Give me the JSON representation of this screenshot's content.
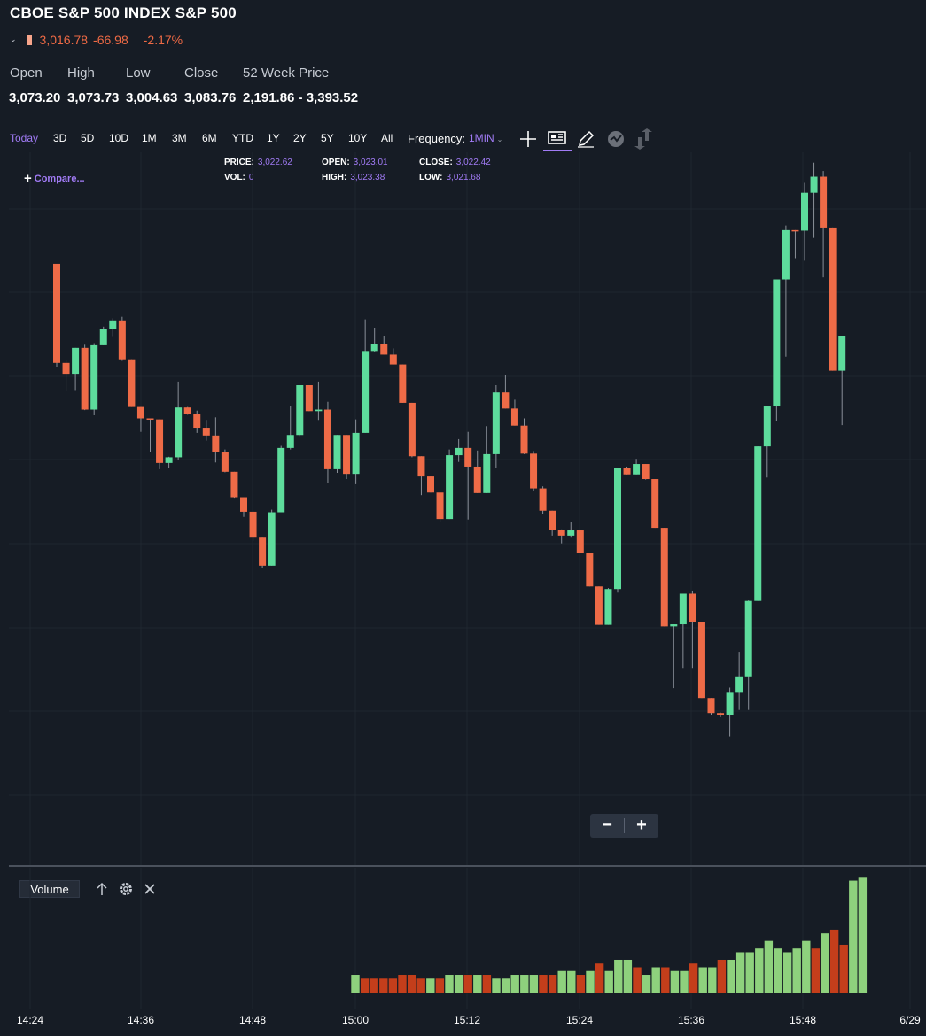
{
  "header": {
    "title": "CBOE S&P 500 INDEX S&P 500",
    "price": "3,016.78",
    "change": "-66.98",
    "change_pct": "-2.17%"
  },
  "stats": [
    {
      "label": "Open",
      "value": "3,073.20"
    },
    {
      "label": "High",
      "value": "3,073.73"
    },
    {
      "label": "Low",
      "value": "3,004.63"
    },
    {
      "label": "Close",
      "value": "3,083.76"
    },
    {
      "label": "52 Week Price",
      "value": "2,191.86 - 3,393.52"
    }
  ],
  "toolbar": {
    "ranges": [
      "Today",
      "3D",
      "5D",
      "10D",
      "1M",
      "3M",
      "6M",
      "YTD",
      "1Y",
      "2Y",
      "5Y",
      "10Y",
      "All"
    ],
    "active_range": "Today",
    "frequency_label": "Frequency:",
    "frequency_value": "1MIN",
    "icons": [
      "crosshair-icon",
      "news-icon",
      "draw-pencil-icon",
      "events-icon",
      "share-icon"
    ]
  },
  "crosshair_info": {
    "price_label": "PRICE:",
    "price": "3,022.62",
    "open_label": "OPEN:",
    "open": "3,023.01",
    "close_label": "CLOSE:",
    "close": "3,022.42",
    "vol_label": "VOL:",
    "vol": "0",
    "high_label": "HIGH:",
    "high": "3,023.38",
    "low_label": "LOW:",
    "low": "3,021.68"
  },
  "compare": {
    "plus": "+",
    "label": "Compare..."
  },
  "zoom": {
    "minus": "−",
    "plus": "+"
  },
  "volume_panel": {
    "label": "Volume",
    "icons": [
      "arrow-up-icon",
      "gear-icon",
      "close-icon"
    ]
  },
  "colors": {
    "up": "#5ddc9c",
    "down": "#ee6b47",
    "vol_up": "#8ed17d",
    "vol_down": "#c43e1b",
    "accent": "#a17bf5",
    "background": "#161c25"
  },
  "x_axis": {
    "labels": [
      "14:24",
      "14:36",
      "14:48",
      "15:00",
      "15:12",
      "15:24",
      "15:36",
      "15:48",
      "6/29"
    ]
  },
  "chart_data": {
    "type": "candlestick",
    "time_axis_labels": [
      "14:24",
      "14:36",
      "14:48",
      "15:00",
      "15:12",
      "15:24",
      "15:36",
      "15:48",
      "6/29"
    ],
    "series": [
      {
        "name": "S&P 500",
        "candles": [
          [
            3064,
            3064,
            3044.1,
            3044.9
          ],
          [
            3044.9,
            3045.4,
            3039.4,
            3042.8
          ],
          [
            3042.8,
            3047.8,
            3039.5,
            3047.8
          ],
          [
            3047.8,
            3048.4,
            3035.8,
            3035.9
          ],
          [
            3035.9,
            3048.7,
            3034.8,
            3048.3
          ],
          [
            3048.3,
            3051.9,
            3048.3,
            3051.4
          ],
          [
            3051.4,
            3053.5,
            3049.9,
            3053.1
          ],
          [
            3053.1,
            3053.8,
            3045.3,
            3045.6
          ],
          [
            3045.6,
            3045.6,
            3036.4,
            3036.4
          ],
          [
            3036.4,
            3036.4,
            3031.6,
            3034.2
          ],
          [
            3034.2,
            3034.2,
            3027.8,
            3034
          ],
          [
            3034,
            3034,
            3024.4,
            3025.6
          ],
          [
            3025.6,
            3026.8,
            3024.7,
            3026.7
          ],
          [
            3026.7,
            3041.3,
            3026.2,
            3036.3
          ],
          [
            3036.3,
            3036.4,
            3034.9,
            3035.1
          ],
          [
            3035.1,
            3035.7,
            3031.4,
            3032.4
          ],
          [
            3032.4,
            3033.9,
            3029.9,
            3030.9
          ],
          [
            3030.9,
            3034.4,
            3025.7,
            3027.7
          ],
          [
            3027.7,
            3028.2,
            3023.8,
            3023.9
          ],
          [
            3023.9,
            3023.9,
            3018.9,
            3019
          ],
          [
            3019,
            3019,
            3015.2,
            3016.2
          ],
          [
            3016.2,
            3016.3,
            3010.6,
            3011.2
          ],
          [
            3011.2,
            3011.2,
            3005.3,
            3005.8
          ],
          [
            3005.8,
            3016.6,
            3005.8,
            3016.1
          ],
          [
            3016.1,
            3028.9,
            3016.1,
            3028.5
          ],
          [
            3028.5,
            3036.5,
            3028.2,
            3031
          ],
          [
            3031,
            3038.5,
            3030.8,
            3040.6
          ],
          [
            3040.6,
            3040.6,
            3035.7,
            3035.6
          ],
          [
            3035.6,
            3041.3,
            3033.9,
            3035.9
          ],
          [
            3035.9,
            3037.4,
            3021.7,
            3024.4
          ],
          [
            3024.4,
            3031,
            3023.7,
            3031
          ],
          [
            3031,
            3031,
            3022.5,
            3023.5
          ],
          [
            3023.5,
            3034,
            3021.5,
            3031.4
          ],
          [
            3031.4,
            3053.3,
            3031.4,
            3047.2
          ],
          [
            3047.2,
            3051.7,
            3047.1,
            3048.5
          ],
          [
            3048.5,
            3050.1,
            3046.5,
            3046.5
          ],
          [
            3046.5,
            3047.7,
            3044.6,
            3044.6
          ],
          [
            3044.6,
            3044.6,
            3037.2,
            3037.2
          ],
          [
            3037.2,
            3037.2,
            3026.7,
            3026.9
          ],
          [
            3026.9,
            3026.9,
            3019.4,
            3023
          ],
          [
            3023,
            3023,
            3020.3,
            3019.9
          ],
          [
            3019.9,
            3019.9,
            3014.3,
            3014.8
          ],
          [
            3014.8,
            3028.2,
            3014.8,
            3027.1
          ],
          [
            3027.1,
            3030.2,
            3025.8,
            3028.5
          ],
          [
            3028.5,
            3031.6,
            3014.7,
            3024.9
          ],
          [
            3024.9,
            3028,
            3019.9,
            3019.8
          ],
          [
            3019.8,
            3032.7,
            3019.8,
            3027.3
          ],
          [
            3027.3,
            3040.6,
            3024.6,
            3039.2
          ],
          [
            3039.2,
            3042.6,
            3036.2,
            3036.1
          ],
          [
            3036.1,
            3037.8,
            3032.9,
            3032.8
          ],
          [
            3032.8,
            3034.2,
            3027.3,
            3027.4
          ],
          [
            3027.4,
            3027.9,
            3020.2,
            3020.7
          ],
          [
            3020.7,
            3021.1,
            3015.8,
            3016.4
          ],
          [
            3016.4,
            3016.4,
            3011.6,
            3012.7
          ],
          [
            3012.7,
            3012.8,
            3010.1,
            3011.6
          ],
          [
            3011.6,
            3014.3,
            3011.2,
            3012.6
          ],
          [
            3012.6,
            3012.6,
            3008.6,
            3008.2
          ],
          [
            3008.2,
            3008.2,
            3007.4,
            3001.8
          ],
          [
            3001.8,
            3001.8,
            2995.9,
            2994.4
          ],
          [
            2994.4,
            3001.5,
            2994.4,
            3001.3
          ],
          [
            3001.3,
            3018.7,
            3000.6,
            3024.6
          ],
          [
            3024.6,
            3024.9,
            3023.8,
            3023.4
          ],
          [
            3023.4,
            3026.4,
            3023.9,
            3025.4
          ],
          [
            3025.4,
            3025.4,
            3022.4,
            3022.5
          ],
          [
            3022.5,
            3022.5,
            3013.1,
            3013.1
          ],
          [
            3013.1,
            3013.1,
            2994.8,
            2994.1
          ],
          [
            2994.1,
            2994.1,
            2982.2,
            2994.5
          ],
          [
            2994.5,
            3000.2,
            2986.1,
            3000.4
          ],
          [
            3000.4,
            3001,
            2986.1,
            2994.9
          ],
          [
            2994.9,
            2994.9,
            2980.3,
            2980.3
          ],
          [
            2980.3,
            2980.3,
            2977,
            2977.4
          ],
          [
            2977.4,
            2977.5,
            2976.6,
            2977
          ],
          [
            2977,
            2982.3,
            2972.9,
            2981.3
          ],
          [
            2981.3,
            2989.2,
            2978,
            2984.3
          ],
          [
            2984.3,
            2999.1,
            2978,
            2999
          ],
          [
            2999,
            3022.7,
            2999,
            3028.8
          ],
          [
            3028.8,
            3036.6,
            3022.8,
            3036.5
          ],
          [
            3036.5,
            3046.1,
            3033.7,
            3061
          ],
          [
            3061,
            3071.4,
            3046.1,
            3070.5
          ],
          [
            3070.5,
            3070.5,
            3065.1,
            3070.4
          ],
          [
            3070.4,
            3079.6,
            3064.6,
            3077.7
          ],
          [
            3077.7,
            3083.5,
            3069,
            3080.8
          ],
          [
            3080.8,
            3081.9,
            3061.4,
            3071
          ],
          [
            3071,
            3071,
            3043.4,
            3043.4
          ],
          [
            3043.4,
            3049.3,
            3032.9,
            3050
          ]
        ]
      }
    ],
    "volume": [
      5,
      4,
      4,
      4,
      4,
      5,
      5,
      4,
      4,
      4,
      5,
      5,
      5,
      5,
      5,
      4,
      4,
      5,
      5,
      5,
      5,
      5,
      6,
      6,
      5,
      6,
      8,
      6,
      9,
      9,
      7,
      5,
      7,
      7,
      6,
      6,
      8,
      7,
      7,
      9,
      9,
      11,
      11,
      12,
      14,
      12,
      11,
      12,
      14,
      12,
      16,
      17,
      13,
      30,
      31
    ],
    "volume_up": [
      true,
      false,
      false,
      false,
      false,
      false,
      false,
      false,
      true,
      false,
      true,
      true,
      false,
      true,
      false,
      true,
      true,
      true,
      true,
      true,
      false,
      false,
      true,
      true,
      false,
      true,
      false,
      true,
      true,
      true,
      false,
      true,
      true,
      false,
      true,
      true,
      false,
      true,
      true,
      false,
      true,
      true,
      true,
      true,
      true,
      true,
      true,
      true,
      true,
      false,
      true,
      false,
      false,
      true,
      true
    ]
  }
}
